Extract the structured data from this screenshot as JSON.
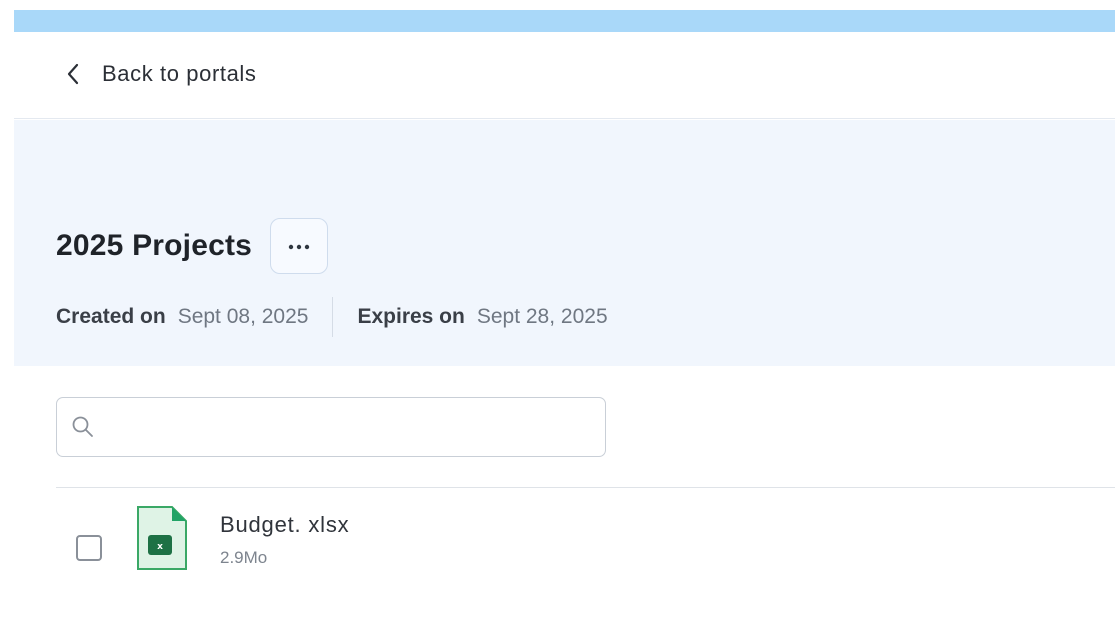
{
  "nav": {
    "back_label": "Back to portals"
  },
  "portal": {
    "title": "2025 Projects",
    "more_icon": "ellipsis-icon",
    "created_label": "Created on",
    "created_value": "Sept 08, 2025",
    "expires_label": "Expires on",
    "expires_value": "Sept 28, 2025"
  },
  "search": {
    "placeholder": "",
    "value": "",
    "icon": "search-icon"
  },
  "files": [
    {
      "name": "Budget. xlsx",
      "size": "2.9Mo",
      "icon": "excel-file-icon",
      "checked": false
    }
  ],
  "colors": {
    "top_strip": "#a9d8f9",
    "header_bg": "#f1f6fd",
    "excel_green": "#1e7145"
  }
}
